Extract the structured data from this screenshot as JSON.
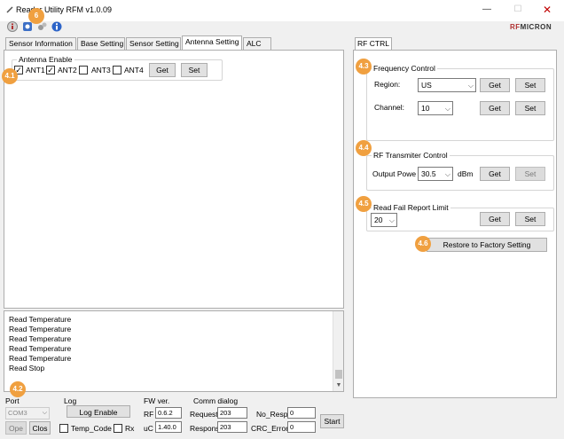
{
  "window": {
    "title": "Reader Utility RFM v1.0.09",
    "minimize_glyph": "—",
    "maximize_glyph": "☐",
    "close_glyph": "✕"
  },
  "logo": {
    "prefix": "RF",
    "accent": "MICRON"
  },
  "badges": {
    "toolbar": "6",
    "antenna": "4.1",
    "log": "4.2",
    "frequency": "4.3",
    "transmitter": "4.4",
    "read_fail": "4.5",
    "restore": "4.6"
  },
  "tabs": [
    {
      "label": "Sensor Information"
    },
    {
      "label": "Base Setting"
    },
    {
      "label": "Sensor Setting"
    },
    {
      "label": "Antenna Setting"
    },
    {
      "label": "ALC"
    }
  ],
  "antenna": {
    "group_title": "Antenna Enable",
    "ant1": {
      "label": "ANT1",
      "checked": "✓"
    },
    "ant2": {
      "label": "ANT2",
      "checked": "✓"
    },
    "ant3": {
      "label": "ANT3",
      "checked": ""
    },
    "ant4": {
      "label": "ANT4",
      "checked": ""
    },
    "get_label": "Get",
    "set_label": "Set"
  },
  "log": {
    "lines": [
      "Read Temperature",
      "Read Temperature",
      "Read Temperature",
      "Read Temperature",
      "Read Temperature",
      "Read Stop"
    ]
  },
  "bottom": {
    "port_label": "Port",
    "port_value": "COM3",
    "open_label": "Ope",
    "close_label": "Clos",
    "log_label": "Log",
    "log_enable_label": "Log Enable",
    "temp_code_label": "Temp_Code",
    "rx_label": "Rx",
    "fw_label": "FW ver.",
    "rf_label": "RF",
    "rf_value": "0.6.2",
    "uc_label": "uC",
    "uc_value": "1.40.0",
    "comm_label": "Comm dialog",
    "request_label": "Request",
    "request_value": "203",
    "response_label": "Respons",
    "response_value": "203",
    "noresp_label": "No_Resp",
    "noresp_value": "0",
    "crc_label": "CRC_Error",
    "crc_value": "0",
    "start_label": "Start"
  },
  "rf_ctrl": {
    "tab_label": "RF CTRL",
    "frequency": {
      "title": "Frequency Control",
      "region_label": "Region:",
      "region_value": "US",
      "channel_label": "Channel:",
      "channel_value": "10",
      "get_label": "Get",
      "set_label": "Set"
    },
    "transmitter": {
      "title": "RF Transmiter Control",
      "power_label": "Output Powe",
      "power_value": "30.5",
      "unit": "dBm",
      "get_label": "Get",
      "set_label": "Set"
    },
    "read_fail": {
      "title": "Read Fail Report Limit",
      "value": "20",
      "get_label": "Get",
      "set_label": "Set"
    },
    "restore_label": "Restore to Factory Setting"
  }
}
